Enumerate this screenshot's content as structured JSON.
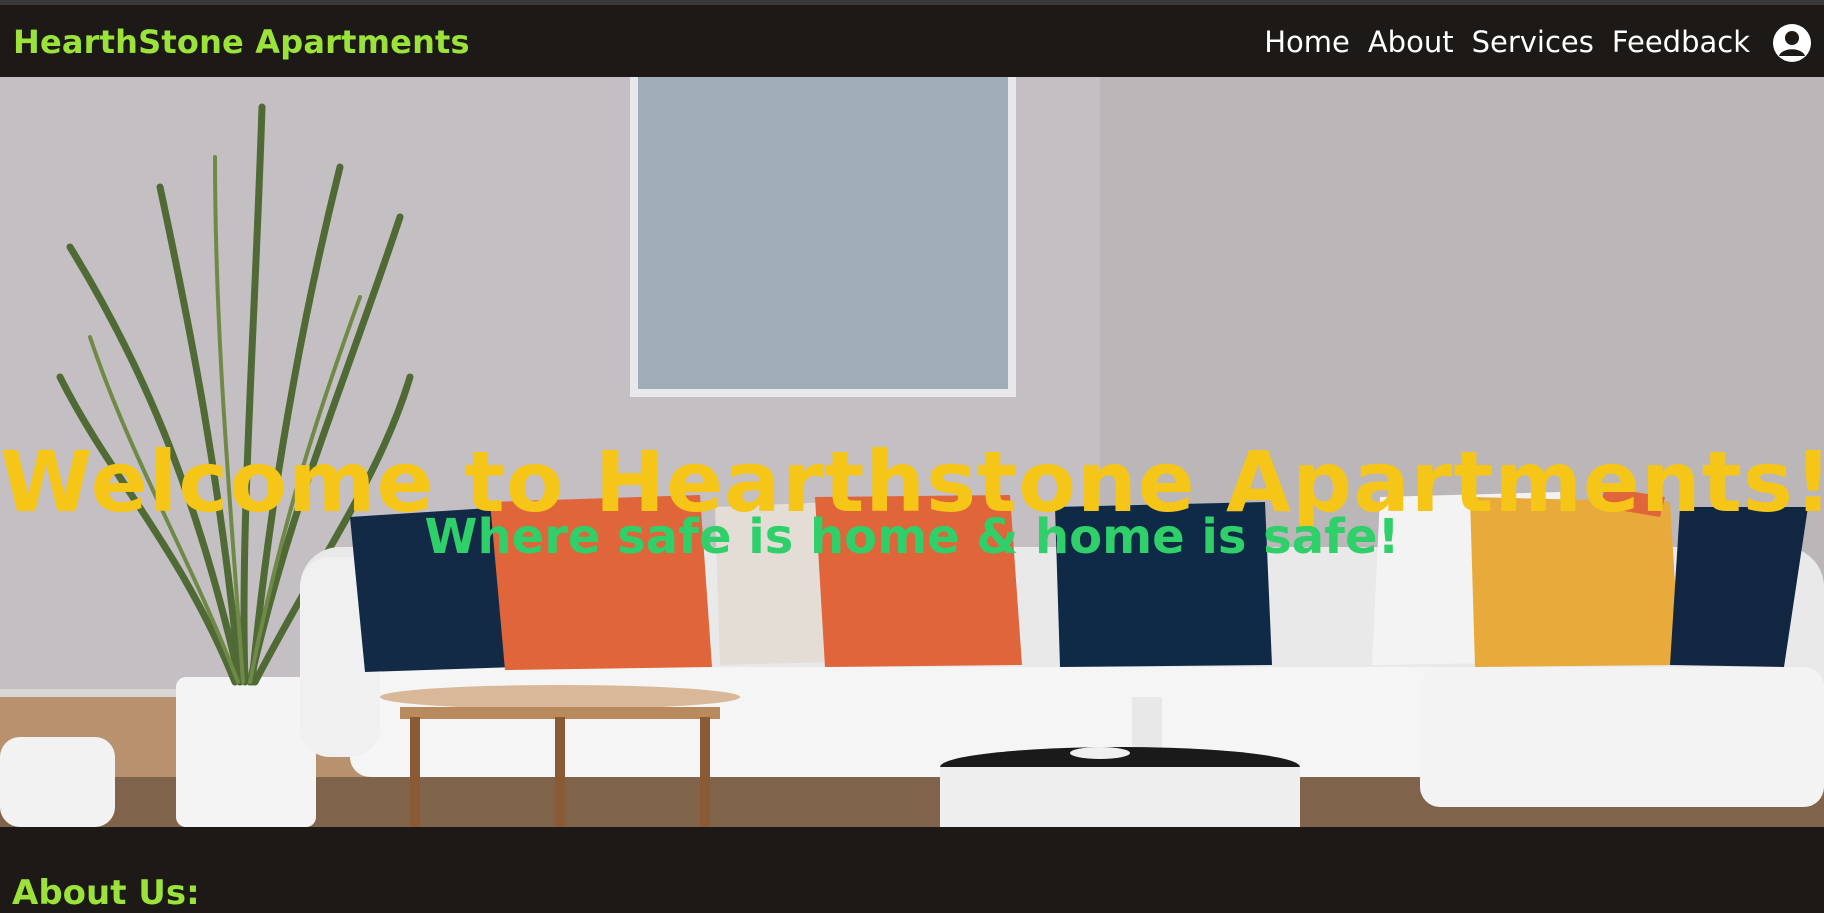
{
  "header": {
    "brand": "HearthStone Apartments",
    "nav": [
      "Home",
      "About",
      "Services",
      "Feedback"
    ],
    "account_icon": "user-circle-icon"
  },
  "hero": {
    "title": "Welcome to Hearthstone Apartments!",
    "subtitle": "Where safe is home & home is safe!"
  },
  "about": {
    "title": "About Us:"
  },
  "colors": {
    "navbar": "#1c1917",
    "brand": "#9be33a",
    "hero_title": "#f5c518",
    "hero_subtitle": "#2fd06a"
  }
}
